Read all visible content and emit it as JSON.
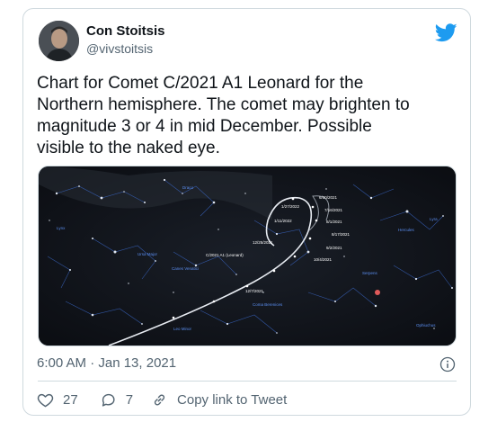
{
  "author": {
    "name": "Con Stoitsis",
    "handle": "@vivstoitsis",
    "avatar_icon": "profile-photo"
  },
  "brand": {
    "icon": "twitter-bird-icon",
    "color": "#1d9bf0"
  },
  "tweet": {
    "text": "Chart for Comet C/2021 A1 Leonard  for the\nNorthern hemisphere. The comet may brighten to\nmagnitude 3 or 4 in mid December.  Possible\nvisible to the naked eye.",
    "timestamp": "6:00 AM · Jan 13, 2021"
  },
  "media": {
    "type": "star-chart",
    "comet_label": "C/2021 A1 (Leonard)",
    "path_dates": [
      "6/30/2021",
      "7/16/2021",
      "8/1/2021",
      "8/17/2021",
      "9/2/2021",
      "9/18/2021",
      "10/4/2021",
      "10/20/2021",
      "11/5/2021",
      "11/21/2021",
      "12/7/2021",
      "12/25/2021",
      "1/11/2022",
      "1/27/2022"
    ]
  },
  "actions": {
    "like_count": "27",
    "reply_count": "7",
    "copy_label": "Copy link to Tweet"
  },
  "icons": {
    "like": "heart-icon",
    "reply": "speech-bubble-icon",
    "copy": "link-icon",
    "info": "info-icon"
  }
}
